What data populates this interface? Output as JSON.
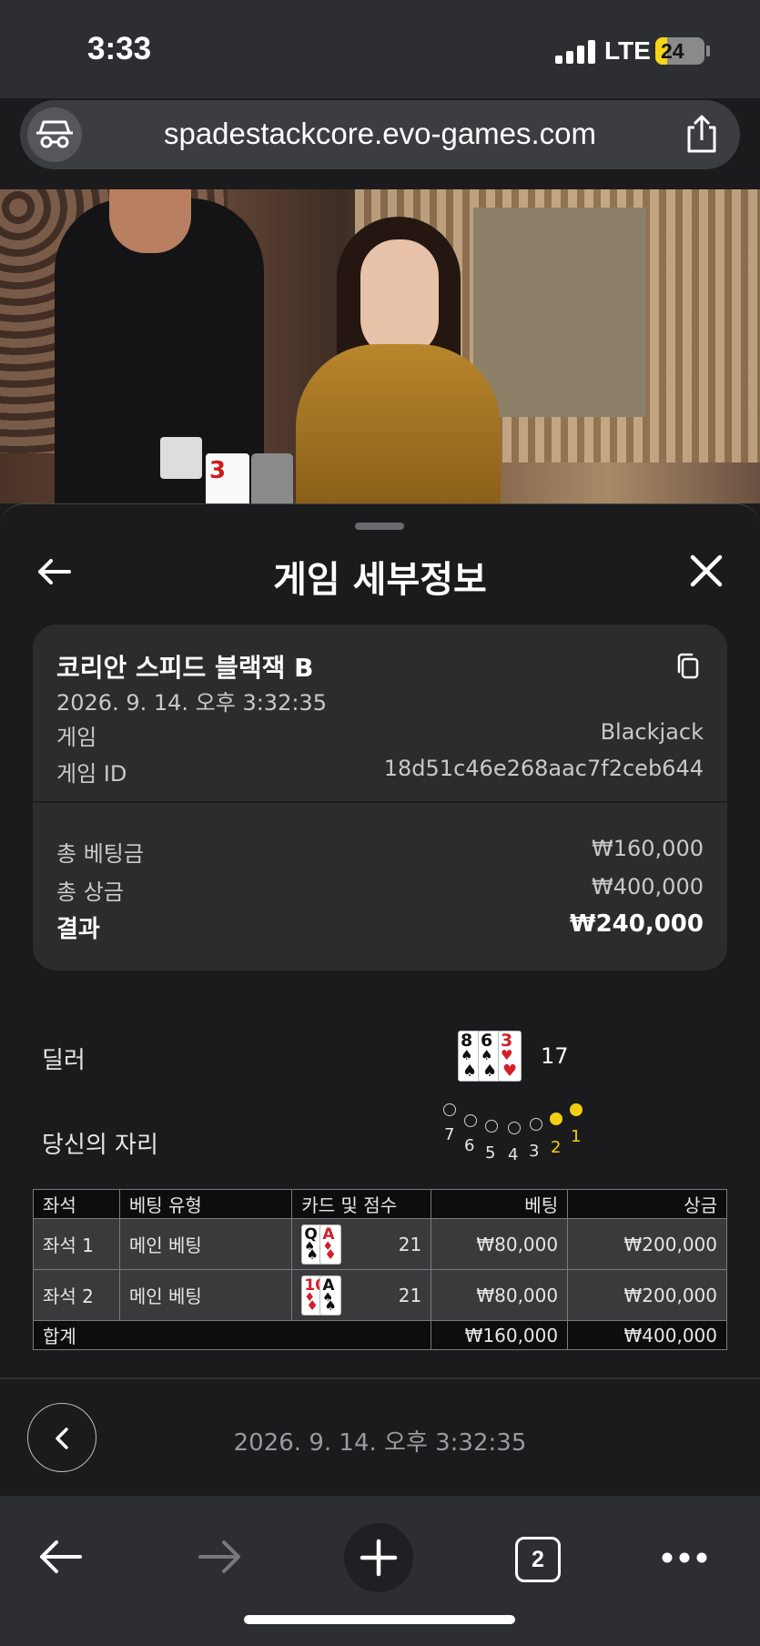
{
  "status_bar": {
    "time": "3:33",
    "network": "LTE",
    "battery": "24",
    "battery_level": 0.24
  },
  "browser": {
    "url": "spadestackcore.evo-games.com",
    "open_tabs": "2",
    "icons": [
      "incognito-icon",
      "share-icon",
      "back-arrow-icon",
      "forward-arrow-icon",
      "plus-icon",
      "tabs-icon",
      "more-icon"
    ]
  },
  "video_card": "3",
  "sheet": {
    "title": "게임 세부정보",
    "game_name": "코리안 스피드 블랙잭 B",
    "datetime": "2026. 9. 14. 오후 3:32:35",
    "game_label": "게임",
    "game_value": "Blackjack",
    "game_id_label": "게임 ID",
    "game_id_value": "18d51c46e268aac7f2ceb644",
    "total_bet_label": "총 베팅금",
    "total_bet_value": "₩160,000",
    "total_win_label": "총 상금",
    "total_win_value": "₩400,000",
    "result_label": "결과",
    "result_value": "₩240,000"
  },
  "dealer": {
    "label": "딜러",
    "cards": [
      {
        "rank": "8",
        "suit": "♠",
        "color": "black"
      },
      {
        "rank": "6",
        "suit": "♠",
        "color": "black"
      },
      {
        "rank": "3",
        "suit": "♥",
        "color": "red"
      }
    ],
    "score": "17"
  },
  "seats": {
    "label": "당신의 자리",
    "positions": [
      {
        "n": "7",
        "active": false
      },
      {
        "n": "6",
        "active": false
      },
      {
        "n": "5",
        "active": false
      },
      {
        "n": "4",
        "active": false
      },
      {
        "n": "3",
        "active": false
      },
      {
        "n": "2",
        "active": true
      },
      {
        "n": "1",
        "active": true
      }
    ]
  },
  "table": {
    "headers": [
      "좌석",
      "베팅 유형",
      "카드 및 점수",
      "베팅",
      "상금"
    ],
    "rows": [
      {
        "seat": "좌석 1",
        "type": "메인 베팅",
        "cards": [
          {
            "rank": "Q",
            "suit": "♠",
            "color": "black"
          },
          {
            "rank": "A",
            "suit": "♦",
            "color": "red"
          }
        ],
        "score": "21",
        "bet": "₩80,000",
        "win": "₩200,000"
      },
      {
        "seat": "좌석 2",
        "type": "메인 베팅",
        "cards": [
          {
            "rank": "10",
            "suit": "♦",
            "color": "red"
          },
          {
            "rank": "A",
            "suit": "♠",
            "color": "black"
          }
        ],
        "score": "21",
        "bet": "₩80,000",
        "win": "₩200,000"
      }
    ],
    "total_label": "합계",
    "total_bet": "₩160,000",
    "total_win": "₩400,000"
  },
  "footer": {
    "datetime": "2026. 9. 14. 오후 3:32:35"
  }
}
